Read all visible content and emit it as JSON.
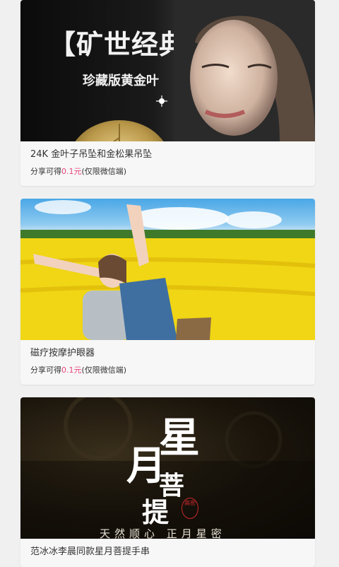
{
  "products": [
    {
      "banner_headline": "【矿世经典】",
      "banner_subline": "珍藏版黄金叶",
      "title": "24K 金叶子吊坠和金松果吊坠",
      "share_prefix": "分享可得",
      "share_price": "0.1元",
      "share_suffix": "(仅限微信端)"
    },
    {
      "title": "磁疗按摩护眼器",
      "share_prefix": "分享可得",
      "share_price": "0.1元",
      "share_suffix": "(仅限微信端)"
    },
    {
      "banner_chars": [
        "星",
        "月",
        "菩",
        "提"
      ],
      "banner_seal": "高密",
      "banner_tagline": "天然顺心 正月星密",
      "title": "范冰冰李晨同款星月菩提手串"
    }
  ],
  "colors": {
    "price_accent": "#e8457a",
    "page_background": "#f0f0f0",
    "card_background": "#f7f7f7"
  }
}
